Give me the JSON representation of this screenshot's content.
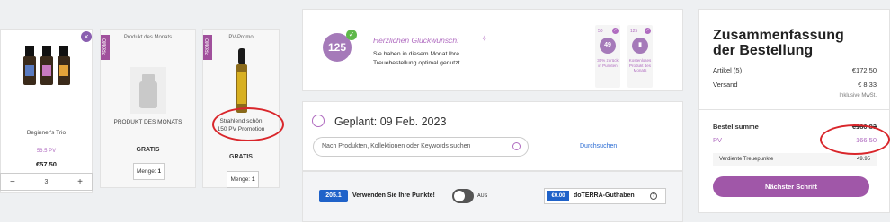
{
  "cards": [
    {
      "name": "Beginner's Trio",
      "pv": "56.5 PV",
      "price": "€57.50",
      "quantity": "3",
      "minus": "−",
      "plus": "+",
      "remove_icon": "×"
    },
    {
      "ribbon": "PROMO",
      "top_label": "Produkt des Monats",
      "name": "PRODUKT DES MONATS",
      "status": "GRATIS",
      "quantity_label": "Menge:",
      "quantity": "1"
    },
    {
      "ribbon": "PROMO",
      "top_label": "PV-Promo",
      "name_line1": "Strahlend schön",
      "name_line2": "150 PV Promotion",
      "status": "GRATIS",
      "quantity_label": "Menge:",
      "quantity": "1"
    }
  ],
  "congrats": {
    "points": "125",
    "title": "Herzlichen Glückwunsch!",
    "text": "Sie haben in diesem Monat Ihre Treuebestellung optimal genutzt.",
    "tiles": [
      {
        "number": "50",
        "value": "49",
        "caption": "30% zurück in Punkten"
      },
      {
        "number": "125",
        "value": "",
        "caption": "Kostenloses Produkt des Monats"
      }
    ]
  },
  "planned": {
    "title": "Geplant: 09 Feb. 2023",
    "search_placeholder": "Nach Produkten, Kollektionen oder Keywords suchen",
    "browse_link": "Durchsuchen"
  },
  "points_bar": {
    "points": "205.1",
    "label": "Verwenden Sie Ihre Punkte!",
    "toggle_state": "AUS",
    "credit_value": "€0.00",
    "credit_label": "doTERRA-Guthaben",
    "info_icon": "?"
  },
  "summary": {
    "title_line1": "Zusammenfassung",
    "title_line2": "der Bestellung",
    "rows": [
      {
        "label": "Artikel (5)",
        "value": "€172.50"
      },
      {
        "label": "Versand",
        "value": "€ 8.33"
      }
    ],
    "tax_note": "Inklusive MwSt.",
    "total_label": "Bestellsumme",
    "total_value": "€180.83",
    "pv_label": "PV",
    "pv_value": "166.50",
    "earned_label": "Verdiente Treuepunkte",
    "earned_value": "49.95",
    "next_button": "Nächster Schritt"
  },
  "colors": {
    "accent": "#a057a8",
    "highlight_circle": "#d9262b",
    "link": "#2a6bd3",
    "points_blue": "#1f62c9"
  }
}
